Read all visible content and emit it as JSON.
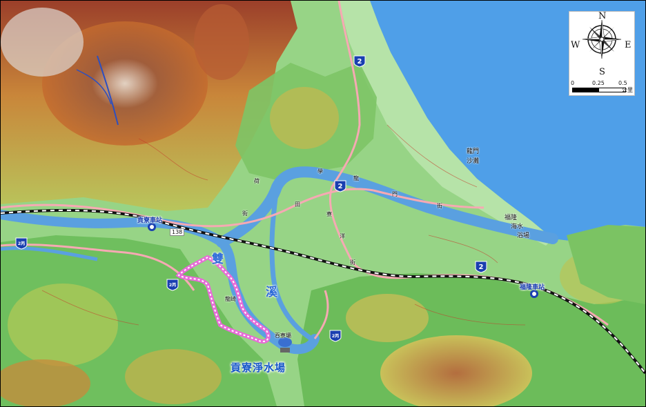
{
  "map": {
    "stations": {
      "gongliao": "貢寮車站",
      "fulong": "福隆車站"
    },
    "river_chars": [
      "雙",
      "溪"
    ],
    "coast_text": [
      "龍門",
      "沙灘"
    ],
    "coast_text2": [
      "福隆",
      "海水",
      "浴場"
    ],
    "road_chars": [
      "學",
      "龍",
      "門",
      "街",
      "田",
      "寮",
      "洋",
      "街",
      "荷",
      "街"
    ],
    "places": {
      "longqiao": "龍崎",
      "dam": "吞寮壩",
      "plant": "貢寮淨水場",
      "road_code": "138"
    },
    "route_shields": [
      {
        "code": "2",
        "kind": "provincial"
      },
      {
        "code": "2",
        "kind": "provincial"
      },
      {
        "code": "2",
        "kind": "provincial"
      },
      {
        "code": "2丙",
        "kind": "provincial-branch"
      },
      {
        "code": "2丙",
        "kind": "provincial-branch"
      },
      {
        "code": "2丙",
        "kind": "provincial-branch"
      }
    ],
    "colors": {
      "sea": "#4f9fe8",
      "river": "#5aa0e0",
      "lowland": "#9fdc8c",
      "hill": "#c9b04a",
      "mountain": "#a6452a",
      "road": "#f6a9b3",
      "railway": "#111111",
      "highlight": "#e86ad8"
    }
  },
  "compass": {
    "north": "N",
    "south": "S",
    "east": "E",
    "west": "W"
  },
  "scale": {
    "ticks": [
      "0",
      "0.25",
      "0.5"
    ],
    "unit": "公里"
  }
}
